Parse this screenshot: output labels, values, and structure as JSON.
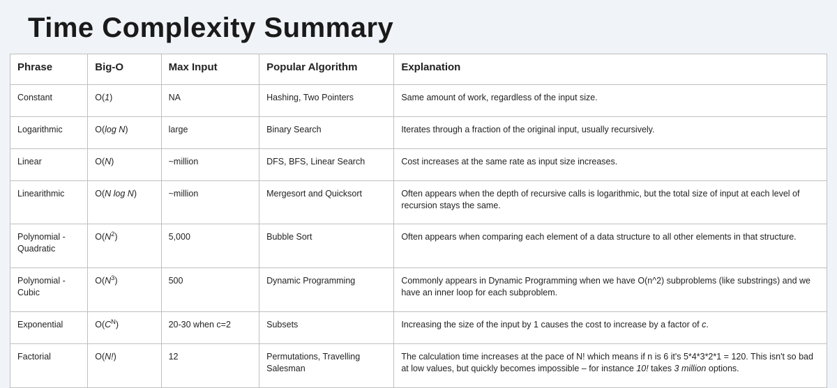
{
  "title": "Time Complexity Summary",
  "headers": {
    "phrase": "Phrase",
    "bigo": "Big-O",
    "max_input": "Max Input",
    "algorithm": "Popular Algorithm",
    "explanation": "Explanation"
  },
  "rows": [
    {
      "phrase": "Constant",
      "bigo_html": "O(<span class='ital'>1</span>)",
      "max_input": "NA",
      "algorithm": "Hashing, Two Pointers",
      "explanation": "Same amount of work, regardless of the input size."
    },
    {
      "phrase": "Logarithmic",
      "bigo_html": "O(<span class='ital'>log N</span>)",
      "max_input": "large",
      "algorithm": "Binary Search",
      "explanation": "Iterates through a fraction of the original input, usually recursively."
    },
    {
      "phrase": "Linear",
      "bigo_html": "O(<span class='ital'>N</span>)",
      "max_input": "~million",
      "algorithm": "DFS, BFS, Linear Search",
      "explanation": "Cost increases at the same rate as input size increases."
    },
    {
      "phrase": "Linearithmic",
      "bigo_html": "O(<span class='ital'>N log N</span>)",
      "max_input": "~million",
      "algorithm": "Mergesort and Quicksort",
      "explanation": "Often appears when the depth of recursive calls is logarithmic, but the total size of input at each level of recursion stays the same."
    },
    {
      "phrase": "Polynomial - Quadratic",
      "bigo_html": "O(<span class='ital'>N</span><sup>2</sup>)",
      "max_input": "5,000",
      "algorithm": "Bubble Sort",
      "explanation": "Often appears when comparing each element of a data structure to all other elements in that structure."
    },
    {
      "phrase": "Polynomial - Cubic",
      "bigo_html": "O(<span class='ital'>N</span><sup>3</sup>)",
      "max_input": "500",
      "algorithm": "Dynamic Programming",
      "explanation": "Commonly appears in Dynamic Programming when we have O(n^2) subproblems (like substrings) and we have an inner loop for each subproblem."
    },
    {
      "phrase": "Exponential",
      "bigo_html": "O(<span class='ital'>C</span><sup>N</sup>)",
      "max_input": "20-30 when c=2",
      "algorithm": "Subsets",
      "explanation_html": "Increasing the size of the input by 1 causes the cost to increase by a factor of <span class='ital'>c</span>."
    },
    {
      "phrase": "Factorial",
      "bigo_html": "O(<span class='ital'>N!</span>)",
      "max_input": "12",
      "algorithm": "Permutations, Travelling Salesman",
      "explanation_html": "The calculation time increases at the pace of N! which means if n is 6 it's 5*4*3*2*1 = 120. This isn't so bad at low values, but quickly becomes impossible – for instance <span class='ital'>10!</span> takes <span class='ital'>3 million</span> options."
    }
  ]
}
